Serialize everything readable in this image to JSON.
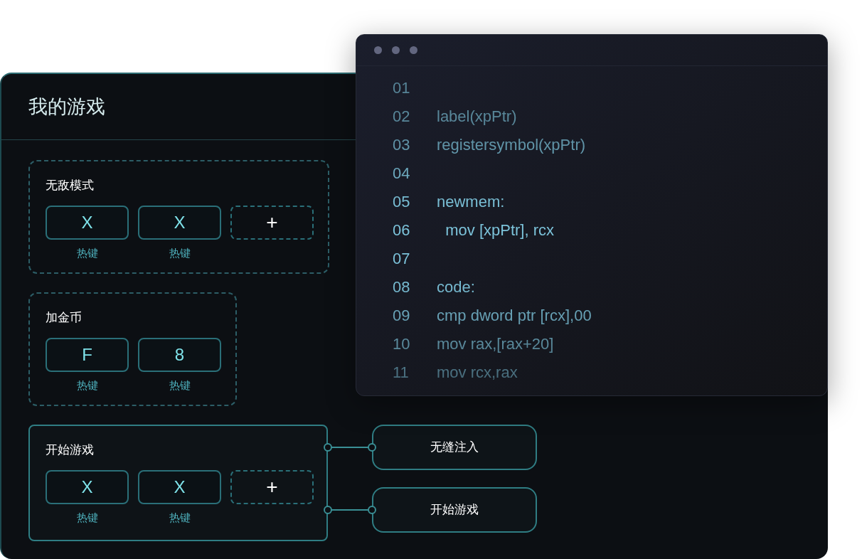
{
  "panel": {
    "title": "我的游戏"
  },
  "groups": [
    {
      "name": "无敌模式",
      "active": false,
      "keys": [
        {
          "kind": "key",
          "label": "X",
          "caption": "热键"
        },
        {
          "kind": "key",
          "label": "X",
          "caption": "热键"
        },
        {
          "kind": "add",
          "label": "+"
        }
      ]
    },
    {
      "name": "加金币",
      "active": false,
      "keys": [
        {
          "kind": "key",
          "label": "F",
          "caption": "热键"
        },
        {
          "kind": "key",
          "label": "8",
          "caption": "热键"
        }
      ]
    },
    {
      "name": "开始游戏",
      "active": true,
      "keys": [
        {
          "kind": "key",
          "label": "X",
          "caption": "热键"
        },
        {
          "kind": "key",
          "label": "X",
          "caption": "热键"
        },
        {
          "kind": "add",
          "label": "+"
        }
      ],
      "outputs": [
        {
          "label": "无缝注入"
        },
        {
          "label": "开始游戏"
        }
      ]
    }
  ],
  "code_window": {
    "lines": [
      {
        "number": "01"
      },
      {
        "number": "02",
        "code": "label(xpPtr)"
      },
      {
        "number": "03",
        "code": "registersymbol(xpPtr)"
      },
      {
        "number": "04"
      },
      {
        "number": "05",
        "code": "newmem:"
      },
      {
        "number": "06",
        "code": "  mov [xpPtr], rcx"
      },
      {
        "number": "07"
      },
      {
        "number": "08",
        "code": "code:"
      },
      {
        "number": "09",
        "code": "cmp dword ptr [rcx],00"
      },
      {
        "number": "10",
        "code": "mov rax,[rax+20]"
      },
      {
        "number": "11",
        "code": "mov rcx,rax"
      }
    ]
  }
}
